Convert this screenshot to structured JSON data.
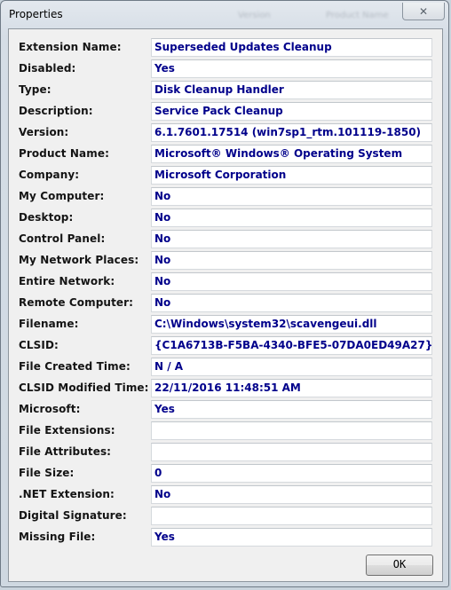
{
  "window": {
    "title": "Properties",
    "close_icon": "close-x-icon",
    "ghost_headers": [
      "Version",
      "Product Name"
    ]
  },
  "fields": [
    {
      "label": "Extension Name:",
      "value": "Superseded Updates Cleanup"
    },
    {
      "label": "Disabled:",
      "value": "Yes"
    },
    {
      "label": "Type:",
      "value": "Disk Cleanup Handler"
    },
    {
      "label": "Description:",
      "value": "Service Pack Cleanup"
    },
    {
      "label": "Version:",
      "value": "6.1.7601.17514 (win7sp1_rtm.101119-1850)"
    },
    {
      "label": "Product Name:",
      "value": "Microsoft® Windows® Operating System"
    },
    {
      "label": "Company:",
      "value": "Microsoft Corporation"
    },
    {
      "label": "My Computer:",
      "value": "No"
    },
    {
      "label": "Desktop:",
      "value": "No"
    },
    {
      "label": "Control Panel:",
      "value": "No"
    },
    {
      "label": "My Network Places:",
      "value": "No"
    },
    {
      "label": "Entire Network:",
      "value": "No"
    },
    {
      "label": "Remote Computer:",
      "value": "No"
    },
    {
      "label": "Filename:",
      "value": "C:\\Windows\\system32\\scavengeui.dll"
    },
    {
      "label": "CLSID:",
      "value": "{C1A6713B-F5BA-4340-BFE5-07DA0ED49A27}"
    },
    {
      "label": "File Created Time:",
      "value": "N / A"
    },
    {
      "label": "CLSID Modified Time:",
      "value": "22/11/2016 11:48:51 AM"
    },
    {
      "label": "Microsoft:",
      "value": "Yes"
    },
    {
      "label": "File Extensions:",
      "value": ""
    },
    {
      "label": "File Attributes:",
      "value": ""
    },
    {
      "label": "File Size:",
      "value": "0"
    },
    {
      "label": ".NET Extension:",
      "value": "No"
    },
    {
      "label": "Digital Signature:",
      "value": ""
    },
    {
      "label": "Missing File:",
      "value": "Yes"
    }
  ],
  "buttons": {
    "ok": "OK"
  }
}
